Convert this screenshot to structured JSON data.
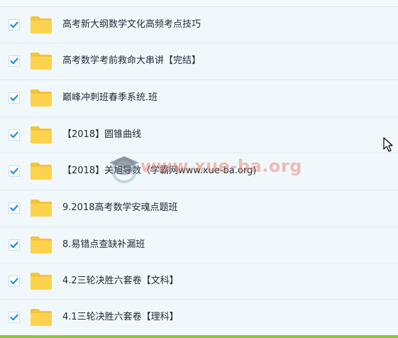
{
  "files": [
    {
      "name": "高考新大纲数学文化高频考点技巧",
      "checked": true,
      "icon": "folder-icon"
    },
    {
      "name": "高考数学考前救命大串讲【完结】",
      "checked": true,
      "icon": "folder-icon"
    },
    {
      "name": "巅峰冲刺班春季系统.班",
      "checked": true,
      "icon": "folder-icon"
    },
    {
      "name": "【2018】圆锥曲线",
      "checked": true,
      "icon": "folder-icon"
    },
    {
      "name": "【2018】关旭导数（学霸网www.xue-ba.org)",
      "checked": true,
      "icon": "folder-icon"
    },
    {
      "name": "9.2018高考数学安魂点题班",
      "checked": true,
      "icon": "folder-icon"
    },
    {
      "name": "8.易错点查缺补漏班",
      "checked": true,
      "icon": "folder-icon"
    },
    {
      "name": "4.2三轮决胜六套卷【文科】",
      "checked": true,
      "icon": "folder-icon"
    },
    {
      "name": "4.1三轮决胜六套卷【理科】",
      "checked": true,
      "icon": "folder-icon"
    }
  ],
  "watermark": {
    "text": "www.xue-ba.org",
    "icon": "graduation-cap-icon"
  },
  "colors": {
    "row_bg": "#f1f8fc",
    "row_border": "#dbe9f4",
    "check": "#1a8fe0",
    "folder": "#ffd24d",
    "folder_tab": "#f5c23a",
    "bottom_bar": "#8fc33c"
  }
}
